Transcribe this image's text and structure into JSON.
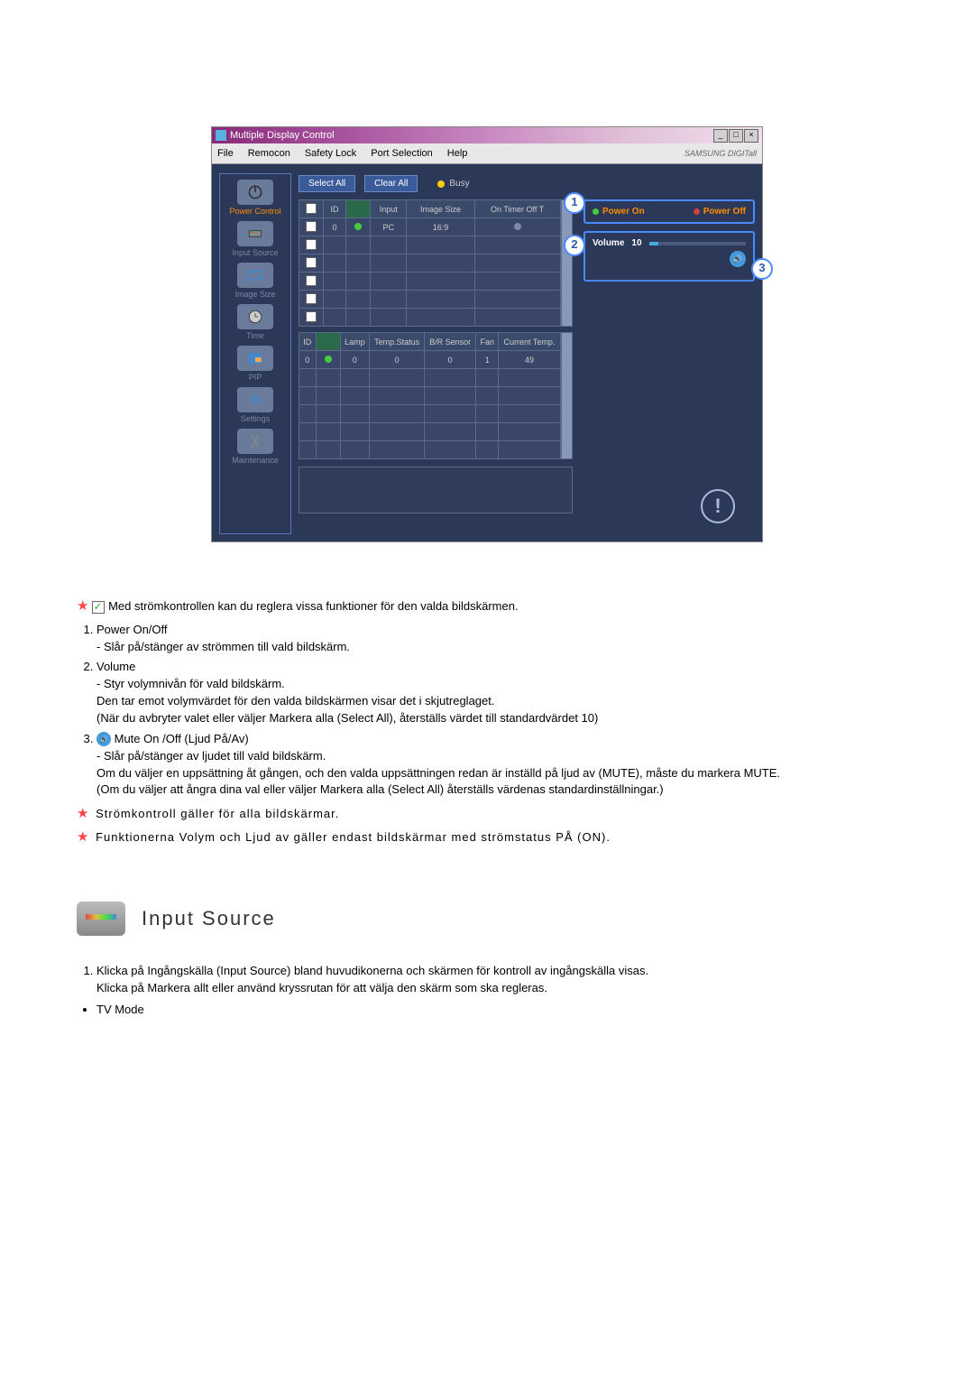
{
  "app": {
    "title": "Multiple Display Control",
    "menu": [
      "File",
      "Remocon",
      "Safety Lock",
      "Port Selection",
      "Help"
    ],
    "brand": "SAMSUNG DIGITall"
  },
  "sidebar": [
    {
      "label": "Power Control",
      "active": true
    },
    {
      "label": "Input Source"
    },
    {
      "label": "Image Size"
    },
    {
      "label": "Time"
    },
    {
      "label": "PIP"
    },
    {
      "label": "Settings"
    },
    {
      "label": "Maintenance"
    }
  ],
  "buttons": {
    "select_all": "Select All",
    "clear_all": "Clear All",
    "busy": "Busy"
  },
  "grid1": {
    "headers": [
      "",
      "ID",
      "",
      "Input",
      "Image Size",
      "On Timer Off T"
    ],
    "row": [
      "",
      "0",
      "",
      "PC",
      "16:9",
      "",
      ""
    ]
  },
  "grid2": {
    "headers": [
      "ID",
      "",
      "Lamp",
      "Temp.Status",
      "B/R Sensor",
      "Fan",
      "Current Temp."
    ],
    "row": [
      "0",
      "",
      "0",
      "0",
      "0",
      "1",
      "49"
    ]
  },
  "panel": {
    "power_on": "Power On",
    "power_off": "Power Off",
    "volume_label": "Volume",
    "volume_value": "10"
  },
  "callouts": {
    "c1": "1",
    "c2": "2",
    "c3": "3"
  },
  "doc": {
    "intro": "Med strömkontrollen kan du reglera vissa funktioner för den valda bildskärmen.",
    "i1_t": "Power On/Off",
    "i1_a": "- Slår på/stänger av strömmen till vald bildskärm.",
    "i2_t": "Volume",
    "i2_a": "- Styr volymnivån för vald bildskärm.",
    "i2_b": "Den tar emot volymvärdet för den valda bildskärmen visar det i skjutreglaget.",
    "i2_c": "(När du avbryter valet eller väljer Markera alla (Select All), återställs värdet till standardvärdet 10)",
    "i3_t": "Mute On /Off (Ljud På/Av)",
    "i3_a": "- Slår på/stänger av ljudet till vald bildskärm.",
    "i3_b": "Om du väljer en uppsättning åt gången, och den valda uppsättningen redan är inställd på ljud av (MUTE), måste du markera MUTE.",
    "i3_c": "(Om du väljer att ångra dina val eller väljer Markera alla (Select All) återställs värdenas standardinställningar.)",
    "note1": "Strömkontroll gäller för alla bildskärmar.",
    "note2": "Funktionerna Volym och Ljud av gäller endast bildskärmar med strömstatus PÅ (ON).",
    "section_title": "Input Source",
    "s1": "Klicka på Ingångskälla (Input Source) bland huvudikonerna och skärmen för kontroll av ingångskälla visas.",
    "s2": "Klicka på Markera allt eller använd kryssrutan för att välja den skärm som ska regleras.",
    "bullet": "TV Mode"
  }
}
